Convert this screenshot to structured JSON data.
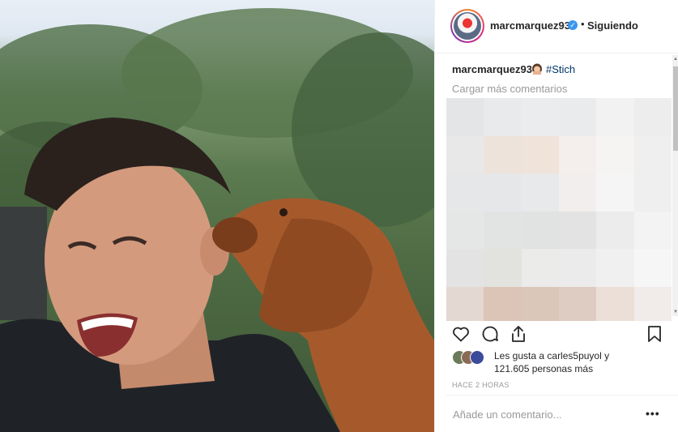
{
  "post": {
    "username": "marcmarquez93",
    "verified_mark": "✓",
    "separator": "•",
    "follow_label": "Siguiendo",
    "caption_user": "marcmarquez93",
    "caption_tag": "#Stich",
    "caption_emoji": "woman-emoji-icon",
    "load_more": "Cargar más comentarios",
    "likes_line1_prefix": "Les gusta a ",
    "likes_user": "carles5puyol",
    "likes_line1_suffix": " y",
    "likes_line2": "121.605 personas más",
    "time_ago": "HACE 2 HORAS",
    "comment_placeholder": "Añade un comentario...",
    "more_options": "•••"
  },
  "icons": {
    "like": "heart-icon",
    "comment": "comment-icon",
    "share": "share-icon",
    "save": "bookmark-icon"
  },
  "colors": {
    "verified": "#3897f0",
    "hashtag": "#003569",
    "muted": "#999999",
    "text": "#262626"
  }
}
